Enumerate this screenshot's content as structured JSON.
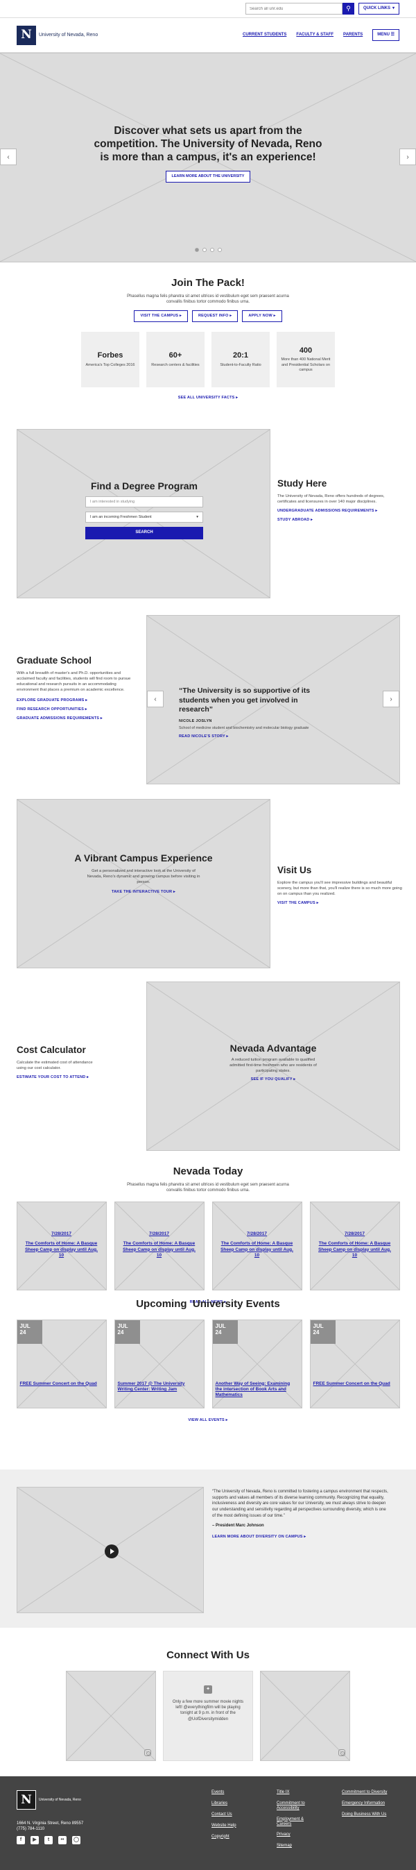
{
  "utility": {
    "search_placeholder": "Search all unr.edu",
    "quick_links": "QUICK LINKS"
  },
  "header": {
    "logo_text": "University of Nevada, Reno",
    "nav": [
      "CURRENT STUDENTS",
      "FACULTY & STAFF",
      "PARENTS"
    ],
    "menu": "MENU"
  },
  "hero": {
    "title": "Discover what sets us apart from the competition. The University of Nevada, Reno is more than a campus, it's an experience!",
    "button": "LEARN MORE ABOUT THE UNIVERSITY"
  },
  "join": {
    "title": "Join The Pack!",
    "intro": "Phasellus magna felis pharetra sit amet ultrices id vestibulum eget sem praesent acurna convallis finibus tortor commodo finibus urna.",
    "buttons": [
      "VISIT THE CAMPUS",
      "REQUEST INFO",
      "APPLY NOW"
    ],
    "stats": [
      {
        "value": "Forbes",
        "desc": "America's Top Colleges 2016"
      },
      {
        "value": "60+",
        "desc": "Research centers & facilities"
      },
      {
        "value": "20:1",
        "desc": "Student-to-Faculty Ratio"
      },
      {
        "value": "400",
        "desc": "More than 400 National Merit and Presidential Scholars on campus"
      }
    ],
    "all_facts": "SEE ALL UNIVERSITY FACTS"
  },
  "degree": {
    "title": "Find a Degree Program",
    "interest_placeholder": "I am interested in studying",
    "student_type": "I am an incoming Freshmen Student",
    "search": "SEARCH",
    "study_title": "Study Here",
    "study_text": "The University of Nevada, Reno offers hundreds of degrees, certificates and licensures in over 140 major disciplines.",
    "links": [
      "UNDERGRADUATE ADMISSIONS REQUIREMENTS",
      "STUDY ABROAD"
    ]
  },
  "grad": {
    "title": "Graduate School",
    "text": "With a full breadth of master's and Ph.D. opportunities and acclaimed faculty and facilities, students will find room to pursue educational and research pursuits in an accommodating environment that places a premium on academic excellence.",
    "links": [
      "EXPLORE GRADUATE PROGRAMS",
      "FIND RESEARCH OPPORTUNITIES",
      "GRADUATE ADMISSIONS REQUIREMENTS"
    ],
    "quote": "“The University is so supportive of its students when you get involved in research”",
    "quote_name": "NICOLE JOSLYN",
    "quote_role": "School of medicine student and biochemistry and molecular biology graduate",
    "quote_link": "READ NICOLE'S STORY"
  },
  "visit": {
    "vibrant_title": "A Vibrant Campus Experience",
    "vibrant_text": "Get a personalized and interactive look at the University of Nevada, Reno's dynamic and growing campus before visiting in person.",
    "vibrant_link": "TAKE THE INTERACTIVE TOUR",
    "title": "Visit Us",
    "text": "Explore the campus you'll see impressive buildings and beautiful scenery, but more than that, you'll realize there is so much more going on on campus than you realized.",
    "link": "VISIT THE CAMPUS"
  },
  "cost": {
    "title": "Cost Calculator",
    "text": "Calculate the estimated cost of attendance using our cost calculator.",
    "link": "ESTIMATE YOUR COST TO ATTEND",
    "adv_title": "Nevada Advantage",
    "adv_text": "A reduced tuition program available to qualified admitted first-time freshmen who are residents of participating states.",
    "adv_link": "SEE IF YOU QUALIFY"
  },
  "news": {
    "title": "Nevada Today",
    "intro": "Phasellus magna felis pharetra sit amet ultrices id vestibulum eget sem praesent acurna convallis finibus tortor commodo finibus urna.",
    "items": [
      {
        "date": "7/28/2017",
        "title": "The Comforts of Home: A Basque Sheep Camp on display until Aug. 10"
      },
      {
        "date": "7/28/2017",
        "title": "The Comforts of Home: A Basque Sheep Camp on display until Aug. 10"
      },
      {
        "date": "7/28/2017",
        "title": "The Comforts of Home: A Basque Sheep Camp on display until Aug. 10"
      },
      {
        "date": "7/28/2017",
        "title": "The Comforts of Home: A Basque Sheep Camp on display until Aug. 10"
      }
    ],
    "all": "READ ALL NEWS"
  },
  "events": {
    "title": "Upcoming  University Events",
    "items": [
      {
        "month": "JUL",
        "day": "24",
        "title": "FREE Summer Concert on the Quad"
      },
      {
        "month": "JUL",
        "day": "24",
        "title": "Summer 2017 @ The University Writing Center: Writing Jam"
      },
      {
        "month": "JUL",
        "day": "24",
        "title": "Another Way of Seeing: Examining the intersection of Book Arts and Mathematics"
      },
      {
        "month": "JUL",
        "day": "24",
        "title": "FREE Summer Concert on the Quad"
      }
    ],
    "all": "VIEW ALL EVENTS"
  },
  "diversity": {
    "quote": "“The University of Nevada, Reno is committed to fostering a campus environment that respects, supports and values all members of its diverse learning community. Recognizing that equality, inclusiveness and diversity are core values for our University, we must always strive to deepen our understanding and sensitivity regarding all perspectives surrounding diversity, which is one of the most defining issues of our time.”",
    "by": "– President Marc Johnson",
    "link": "LEARN MORE ABOUT DIVERSITY ON CAMPUS"
  },
  "connect": {
    "title": "Connect With Us",
    "tweet": "Only a few more summer movie nights left! @everythingfilm will be playing tonight at 9 p.m. in front of the @UofDiversitymidden"
  },
  "footer": {
    "logo_text": "University of Nevada, Reno",
    "address": "1664 N. Virginia Street, Reno 89557",
    "phone": "(775) 784-1110",
    "col1": [
      "Events",
      "Libraries",
      "Contact Us",
      "Website Help",
      "Copyright"
    ],
    "col2": [
      "Title IX",
      "Commitment to Accessibility",
      "Employment & Careers",
      "Privacy",
      "Sitemap"
    ],
    "col3": [
      "Commitment to Diversity",
      "Emergency Information",
      "Doing Business With Us"
    ]
  }
}
